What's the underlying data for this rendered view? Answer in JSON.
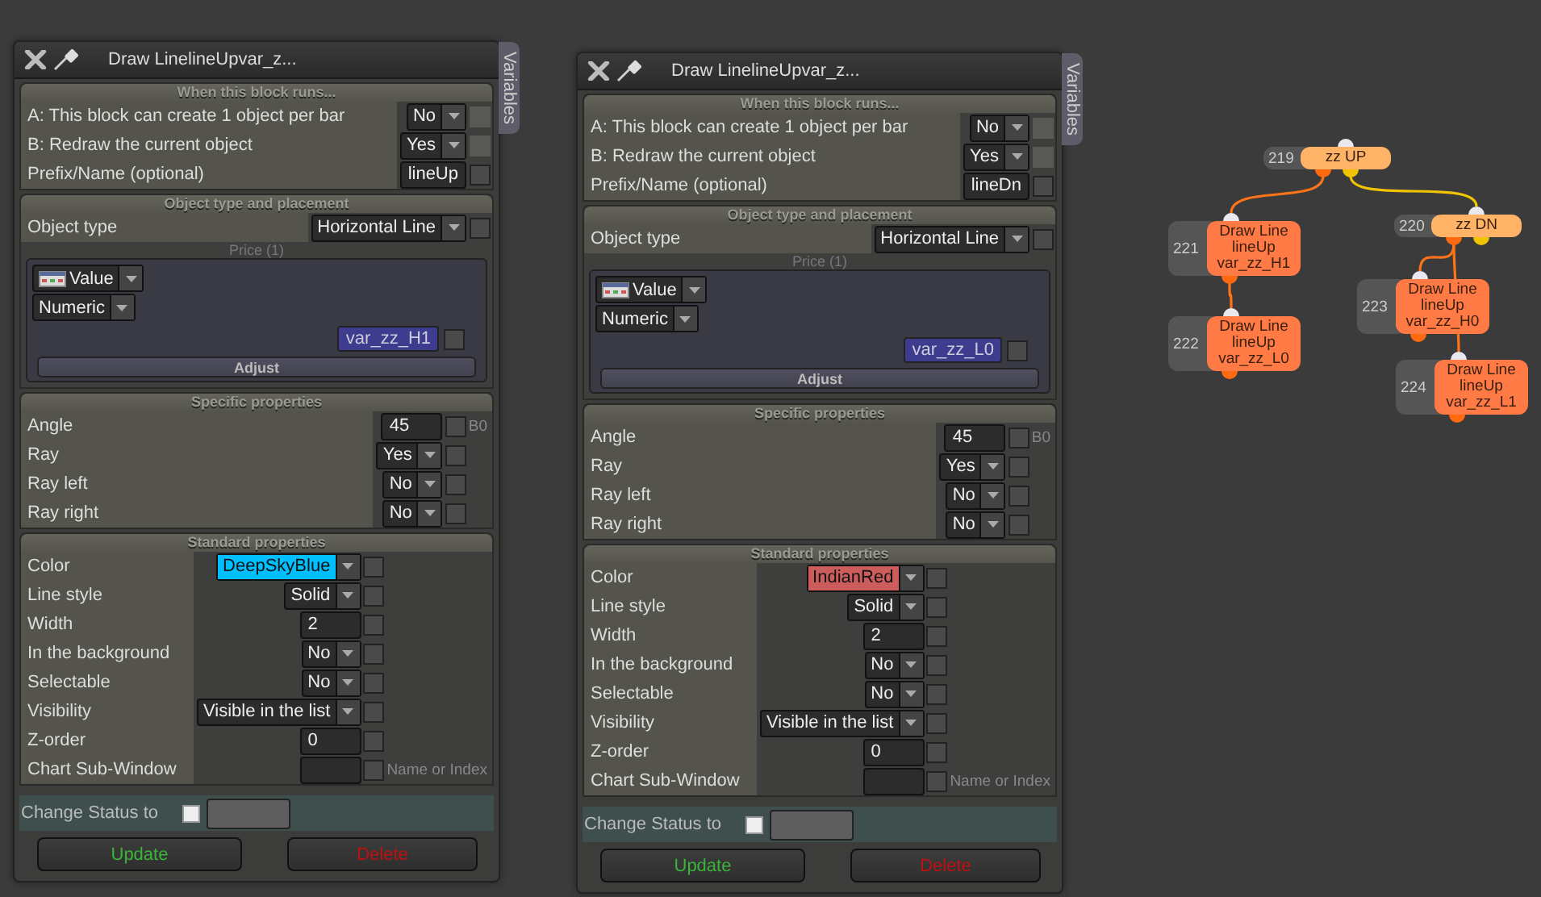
{
  "panels": [
    {
      "title": "Draw LinelineUpvar_z...",
      "side_tab": "Variables",
      "sections": [
        {
          "heading": "When this block runs...",
          "rows": [
            {
              "label": "A: This block can create 1 object per bar",
              "kind": "select",
              "value": "No",
              "checked": false,
              "disabled": true
            },
            {
              "label": "B: Redraw the current object",
              "kind": "select",
              "value": "Yes",
              "checked": false,
              "disabled": true
            },
            {
              "label": "Prefix/Name (optional)",
              "kind": "input",
              "value": "lineUp",
              "checked": false,
              "disabled": false
            }
          ]
        },
        {
          "heading": "Object type and placement",
          "rows": [
            {
              "label": "Object type",
              "kind": "select",
              "value": "Horizontal Line",
              "checked": false,
              "disabled": false
            }
          ],
          "price": {
            "label": "Price (1)",
            "source": "Value",
            "type": "Numeric",
            "variable": "var_zz_H1",
            "checked": false,
            "button": "Adjust"
          }
        },
        {
          "heading": "Specific properties",
          "rows": [
            {
              "label": "Angle",
              "kind": "input",
              "value": "45",
              "checked": false,
              "disabled": false,
              "note": "B0"
            },
            {
              "label": "Ray",
              "kind": "select",
              "value": "Yes",
              "checked": false,
              "disabled": false
            },
            {
              "label": "Ray left",
              "kind": "select",
              "value": "No",
              "checked": false,
              "disabled": false
            },
            {
              "label": "Ray right",
              "kind": "select",
              "value": "No",
              "checked": false,
              "disabled": false
            }
          ]
        },
        {
          "heading": "Standard properties",
          "rows": [
            {
              "label": "Color",
              "kind": "color",
              "value": "DeepSkyBlue",
              "color": "#00bfff",
              "checked": false,
              "disabled": false
            },
            {
              "label": "Line style",
              "kind": "select",
              "value": "Solid",
              "checked": false,
              "disabled": false
            },
            {
              "label": "Width",
              "kind": "input",
              "value": "2",
              "checked": false,
              "disabled": false
            },
            {
              "label": "In the background",
              "kind": "select",
              "value": "No",
              "checked": false,
              "disabled": false
            },
            {
              "label": "Selectable",
              "kind": "select",
              "value": "No",
              "checked": false,
              "disabled": false
            },
            {
              "label": "Visibility",
              "kind": "select",
              "value": "Visible in the list",
              "checked": false,
              "disabled": false
            },
            {
              "label": "Z-order",
              "kind": "input",
              "value": "0",
              "checked": false,
              "disabled": false
            },
            {
              "label": "Chart Sub-Window",
              "kind": "input",
              "checked": false,
              "disabled": false,
              "note": "Name or Index"
            }
          ]
        }
      ],
      "status": {
        "label": "Change Status to",
        "checked": false
      },
      "buttons": [
        {
          "label": "Update",
          "kind": "update"
        },
        {
          "label": "Delete",
          "kind": "delete"
        }
      ]
    },
    {
      "title": "Draw LinelineUpvar_z...",
      "side_tab": "Variables",
      "sections": [
        {
          "heading": "When this block runs...",
          "rows": [
            {
              "label": "A: This block can create 1 object per bar",
              "kind": "select",
              "value": "No",
              "checked": false,
              "disabled": true
            },
            {
              "label": "B: Redraw the current object",
              "kind": "select",
              "value": "Yes",
              "checked": false,
              "disabled": true
            },
            {
              "label": "Prefix/Name (optional)",
              "kind": "input",
              "value": "lineDn",
              "checked": false,
              "disabled": false
            }
          ]
        },
        {
          "heading": "Object type and placement",
          "rows": [
            {
              "label": "Object type",
              "kind": "select",
              "value": "Horizontal Line",
              "checked": false,
              "disabled": false
            }
          ],
          "price": {
            "label": "Price (1)",
            "source": "Value",
            "type": "Numeric",
            "variable": "var_zz_L0",
            "checked": false,
            "button": "Adjust"
          }
        },
        {
          "heading": "Specific properties",
          "rows": [
            {
              "label": "Angle",
              "kind": "input",
              "value": "45",
              "checked": false,
              "disabled": false,
              "note": "B0"
            },
            {
              "label": "Ray",
              "kind": "select",
              "value": "Yes",
              "checked": false,
              "disabled": false
            },
            {
              "label": "Ray left",
              "kind": "select",
              "value": "No",
              "checked": false,
              "disabled": false
            },
            {
              "label": "Ray right",
              "kind": "select",
              "value": "No",
              "checked": false,
              "disabled": false
            }
          ]
        },
        {
          "heading": "Standard properties",
          "rows": [
            {
              "label": "Color",
              "kind": "color",
              "value": "IndianRed",
              "color": "#cd5c5c",
              "checked": false,
              "disabled": false
            },
            {
              "label": "Line style",
              "kind": "select",
              "value": "Solid",
              "checked": false,
              "disabled": false
            },
            {
              "label": "Width",
              "kind": "input",
              "value": "2",
              "checked": false,
              "disabled": false
            },
            {
              "label": "In the background",
              "kind": "select",
              "value": "No",
              "checked": false,
              "disabled": false
            },
            {
              "label": "Selectable",
              "kind": "select",
              "value": "No",
              "checked": false,
              "disabled": false
            },
            {
              "label": "Visibility",
              "kind": "select",
              "value": "Visible in the list",
              "checked": false,
              "disabled": false
            },
            {
              "label": "Z-order",
              "kind": "input",
              "value": "0",
              "checked": false,
              "disabled": false
            },
            {
              "label": "Chart Sub-Window",
              "kind": "input",
              "checked": false,
              "disabled": false,
              "note": "Name or Index"
            }
          ]
        }
      ],
      "status": {
        "label": "Change Status to",
        "checked": false
      },
      "buttons": [
        {
          "label": "Update",
          "kind": "update"
        },
        {
          "label": "Delete",
          "kind": "delete"
        }
      ]
    }
  ],
  "graph": {
    "nodes": [
      {
        "number": "219",
        "kind": "condition",
        "lines": [
          "zz UP"
        ],
        "children": [
          {
            "number": "221",
            "kind": "action",
            "lines": [
              "Draw Line",
              "lineUp",
              "var_zz_H1"
            ],
            "children": [
              {
                "number": "222",
                "kind": "action",
                "lines": [
                  "Draw Line",
                  "lineUp",
                  "var_zz_L0"
                ]
              }
            ]
          },
          {
            "number": "220",
            "kind": "condition",
            "lines": [
              "zz DN"
            ],
            "children": [
              {
                "number": "223",
                "kind": "action",
                "lines": [
                  "Draw Line",
                  "lineUp",
                  "var_zz_H0"
                ]
              },
              {
                "number": "224",
                "kind": "action",
                "lines": [
                  "Draw Line",
                  "lineUp",
                  "var_zz_L1"
                ]
              }
            ]
          }
        ]
      }
    ]
  }
}
